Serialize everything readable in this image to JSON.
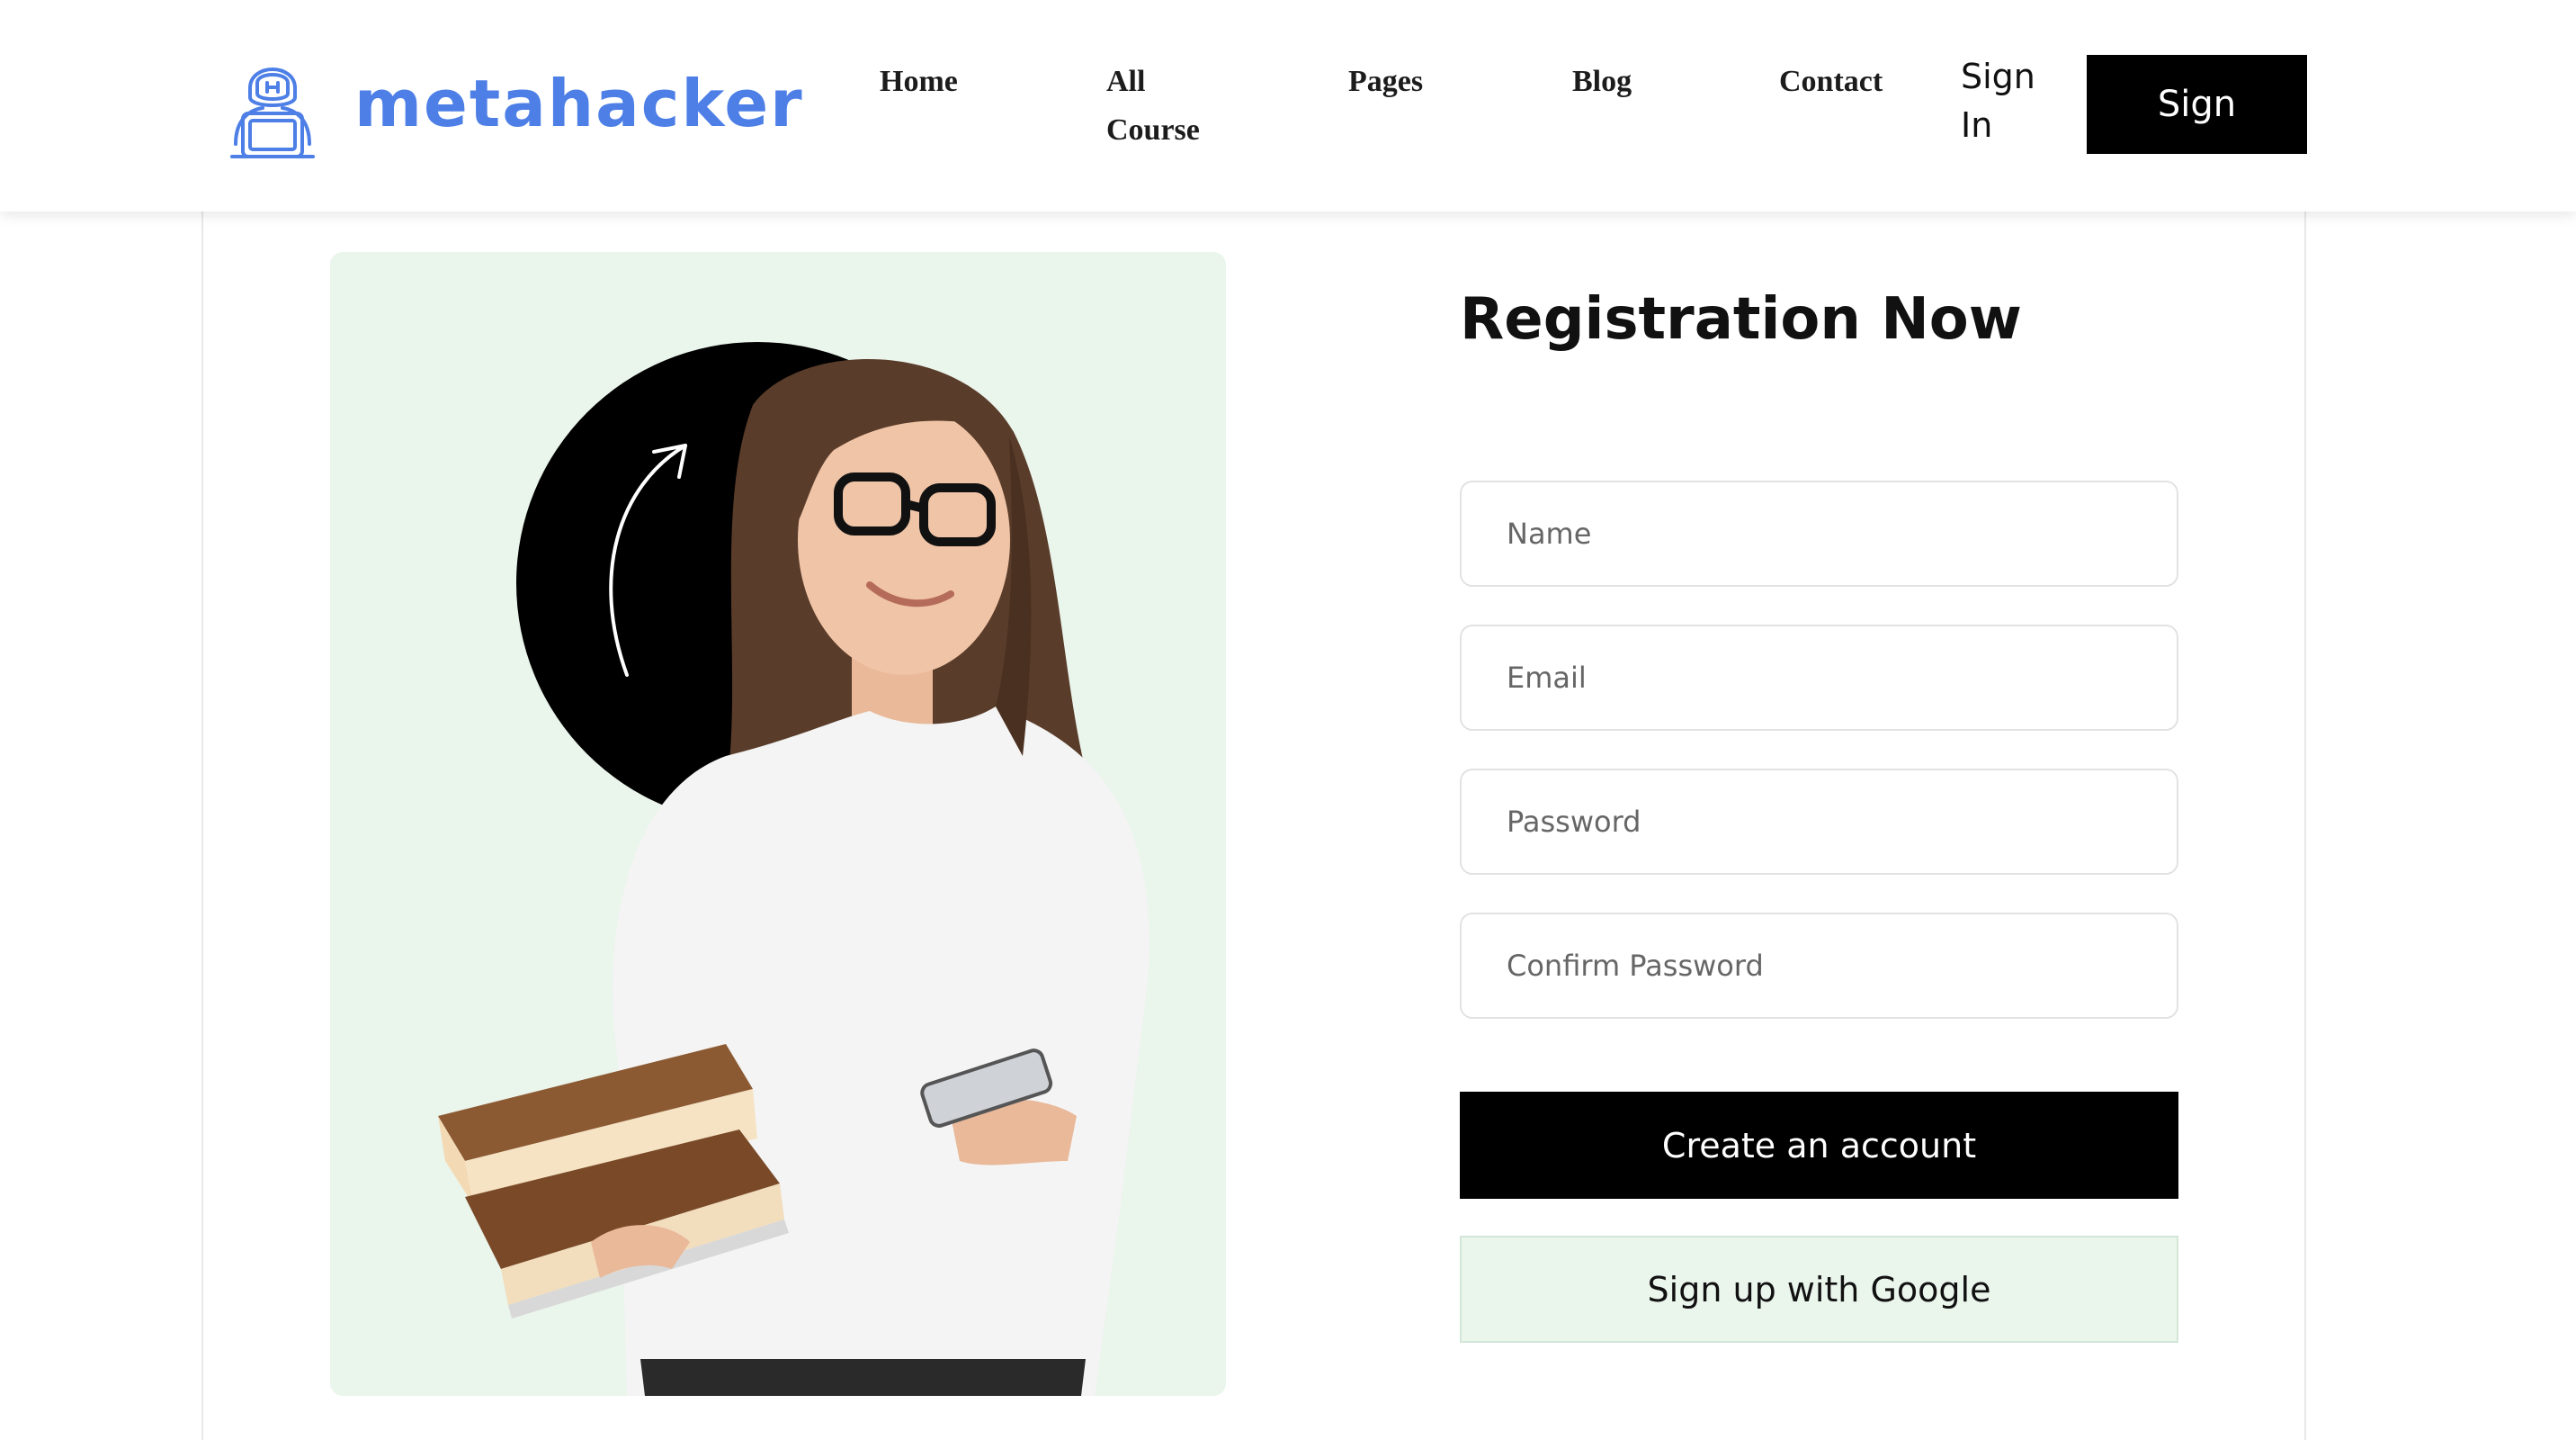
{
  "header": {
    "logo_text": "metahacker",
    "logo_icon": "hacker-laptop-icon",
    "brand_color": "#4d7fe6",
    "nav": {
      "home": "Home",
      "all_course_line1": "All",
      "all_course_line2": "Course",
      "pages": "Pages",
      "blog": "Blog",
      "contact": "Contact",
      "sign_in_line1": "Sign",
      "sign_in_line2": "In"
    },
    "sign_button": "Sign"
  },
  "registration": {
    "title": "Registration Now",
    "name_placeholder": "Name",
    "email_placeholder": "Email",
    "password_placeholder": "Password",
    "confirm_password_placeholder": "Confirm Password",
    "create_button": "Create an account",
    "google_button": "Sign up with Google"
  },
  "colors": {
    "accent_bg": "#eaf5ec",
    "primary_button": "#000000"
  }
}
